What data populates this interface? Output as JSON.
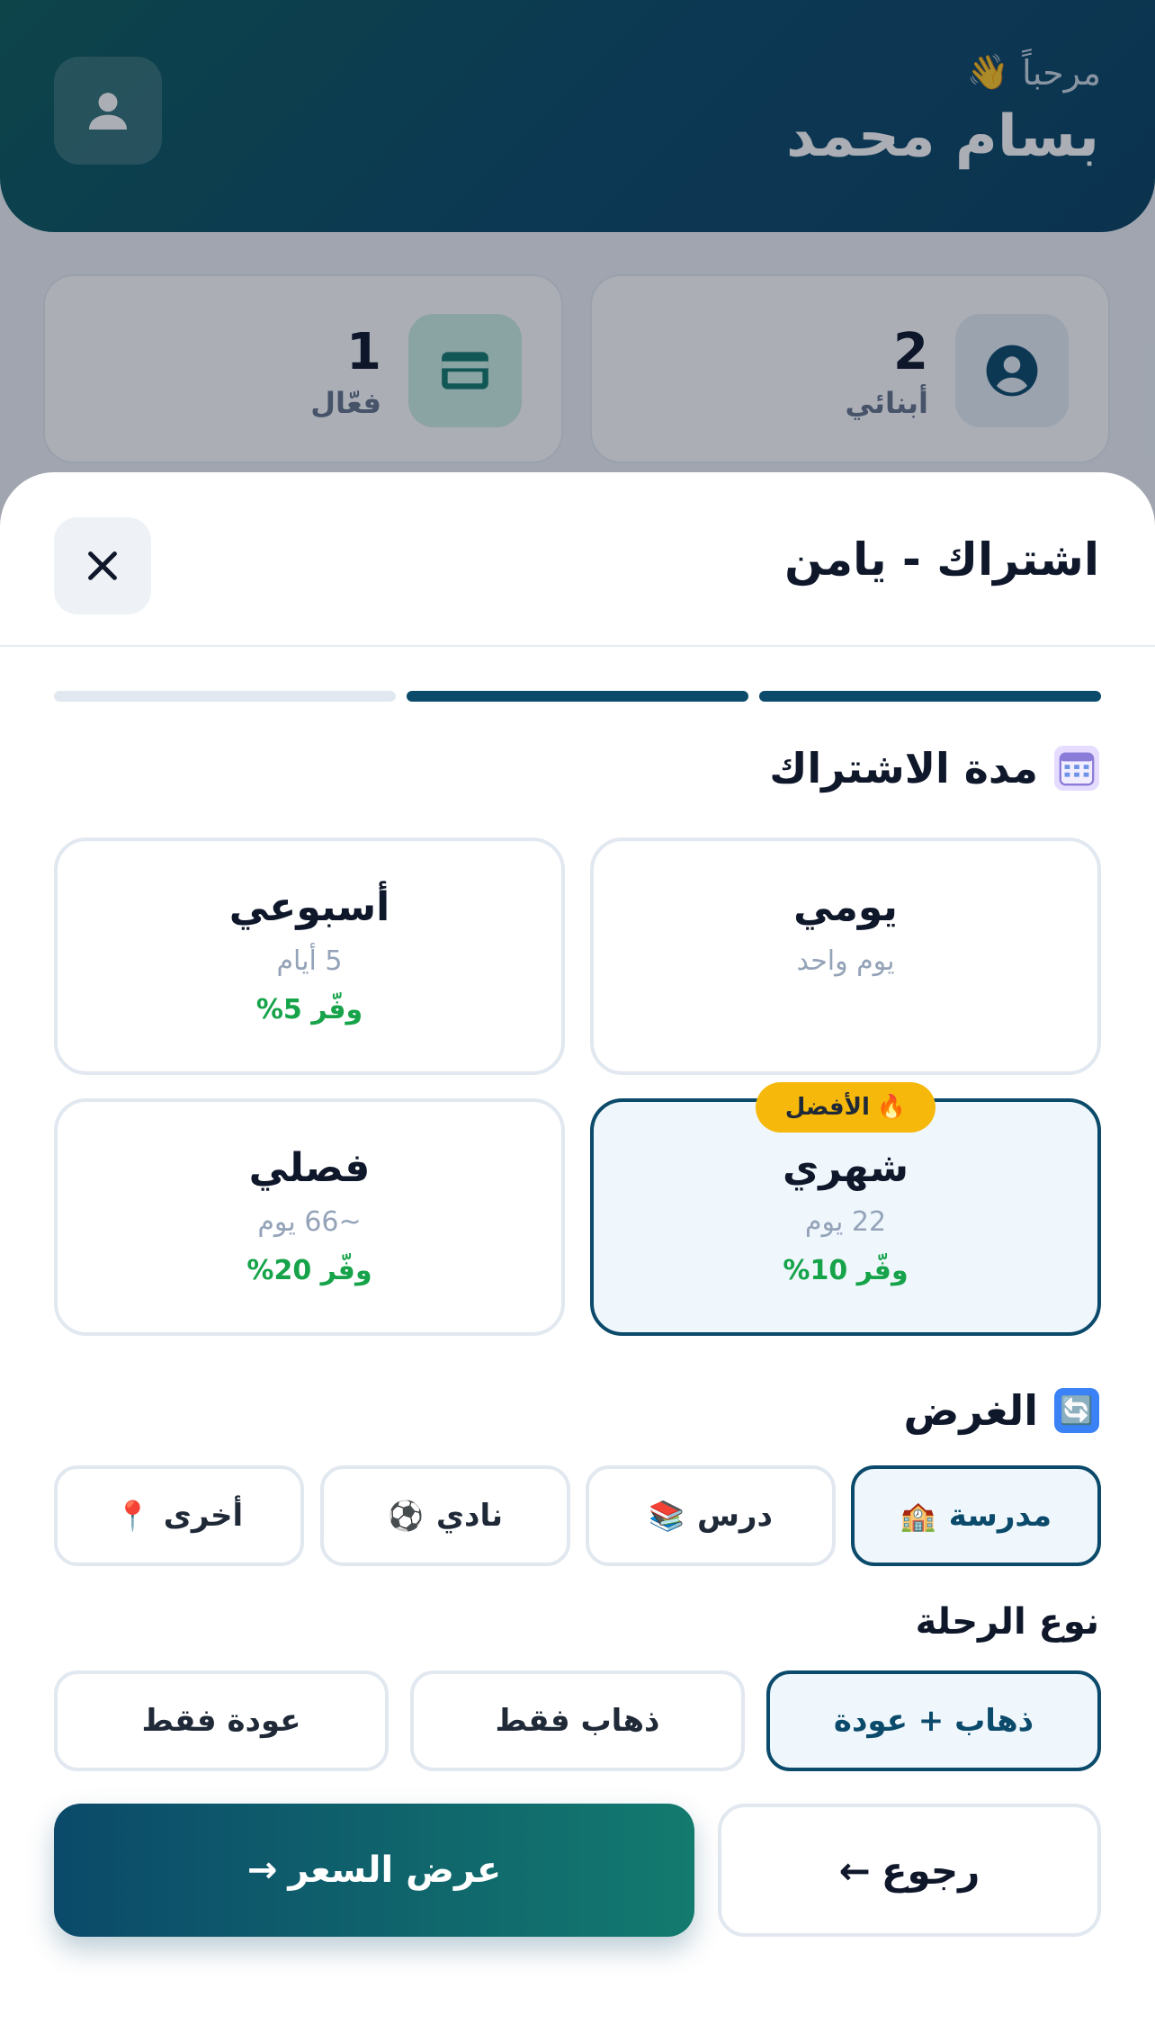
{
  "header": {
    "greeting": "مرحباً",
    "greeting_icon": "👋",
    "user_name": "بسام محمد"
  },
  "stats": [
    {
      "value": "2",
      "label": "أبنائي",
      "icon": "account-circle-icon",
      "color": "#0b4a6a"
    },
    {
      "value": "1",
      "label": "فعّال",
      "icon": "credit-card-icon",
      "color": "#137a6e"
    }
  ],
  "sheet": {
    "title": "اشتراك - يامن",
    "progress": {
      "steps_total": 3,
      "steps_completed": 2
    }
  },
  "duration": {
    "title": "مدة الاشتراك",
    "icon": "calendar-icon",
    "options": [
      {
        "name": "يومي",
        "sub": "يوم واحد",
        "save": "",
        "selected": false
      },
      {
        "name": "أسبوعي",
        "sub": "5 أيام",
        "save": "وفّر 5%",
        "selected": false
      },
      {
        "name": "شهري",
        "sub": "22 يوم",
        "save": "وفّر 10%",
        "selected": true,
        "badge": "الأفضل",
        "badge_icon": "🔥"
      },
      {
        "name": "فصلي",
        "sub": "~66 يوم",
        "save": "وفّر 20%",
        "selected": false
      }
    ]
  },
  "purpose": {
    "title": "الغرض",
    "icon": "🔄",
    "options": [
      {
        "label": "مدرسة",
        "icon": "🏫",
        "selected": true
      },
      {
        "label": "درس",
        "icon": "📚",
        "selected": false
      },
      {
        "label": "نادي",
        "icon": "⚽",
        "selected": false
      },
      {
        "label": "أخرى",
        "icon": "📍",
        "selected": false
      }
    ]
  },
  "trip_type": {
    "title": "نوع الرحلة",
    "options": [
      {
        "label": "ذهاب + عودة",
        "selected": true
      },
      {
        "label": "ذهاب فقط",
        "selected": false
      },
      {
        "label": "عودة فقط",
        "selected": false
      }
    ]
  },
  "actions": {
    "next_label": "عرض السعر",
    "next_arrow": "→",
    "back_label": "رجوع",
    "back_arrow": "←"
  },
  "colors": {
    "primary": "#0b4a6a",
    "accent_teal": "#137a6e",
    "success": "#16a34a",
    "badge": "#f5b80b"
  }
}
